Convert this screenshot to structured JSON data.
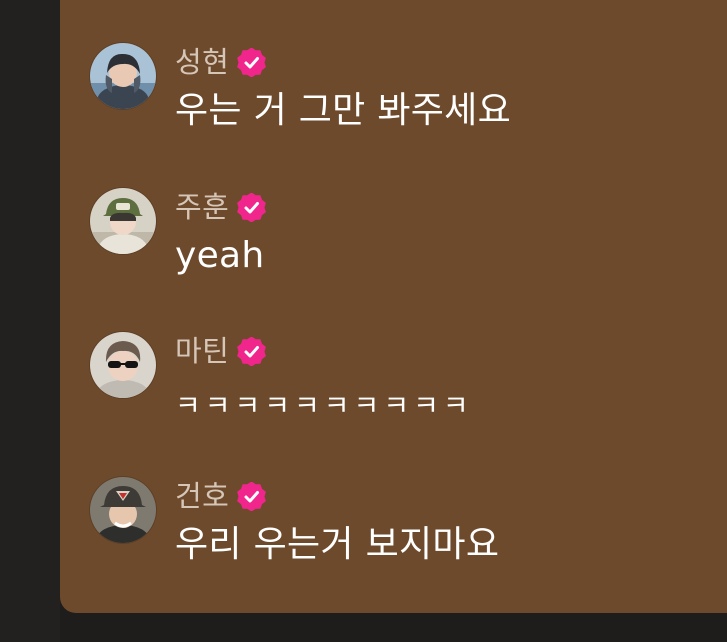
{
  "theme": {
    "panel_bg": "#6e4a2c",
    "verified_color": "#f0268c"
  },
  "messages": [
    {
      "name": "성현",
      "text": "우는 거 그만 봐주세요",
      "avatar_icon": "user-avatar-icon",
      "verified_icon": "verified-badge-icon"
    },
    {
      "name": "주훈",
      "text": "yeah",
      "avatar_icon": "user-avatar-icon",
      "verified_icon": "verified-badge-icon"
    },
    {
      "name": "마틴",
      "text": "ㅋㅋㅋㅋㅋㅋㅋㅋㅋㅋ",
      "avatar_icon": "user-avatar-icon",
      "verified_icon": "verified-badge-icon"
    },
    {
      "name": "건호",
      "text": "우리 우는거 보지마요",
      "avatar_icon": "user-avatar-icon",
      "verified_icon": "verified-badge-icon"
    }
  ]
}
